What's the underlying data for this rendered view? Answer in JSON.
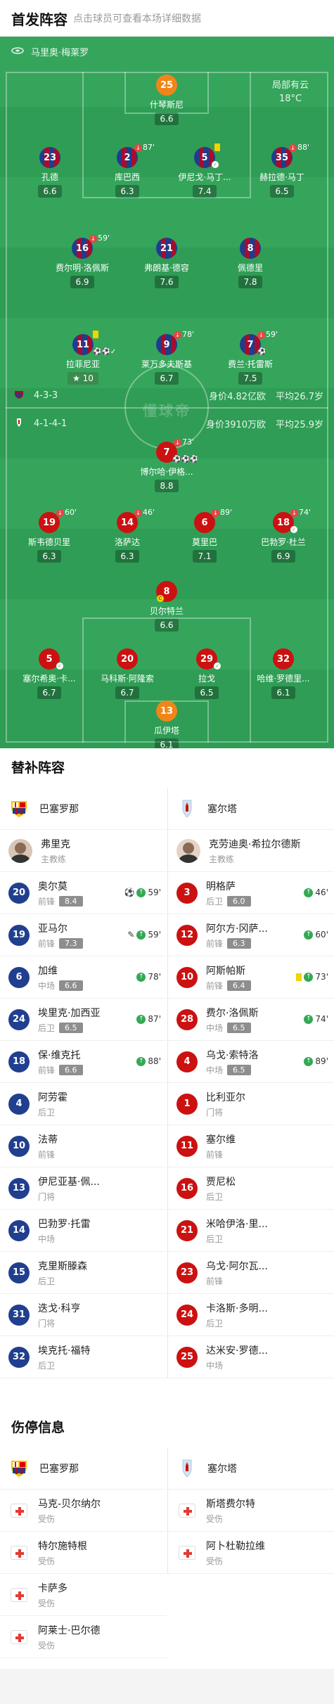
{
  "header": {
    "title": "首发阵容",
    "subtitle": "点击球员可查看本场详细数据"
  },
  "pitch": {
    "venue": "马里奥·梅莱罗",
    "weather_line1": "局部有云",
    "weather_line2": "18°C",
    "watermark": "懂球帝",
    "barca_info": {
      "formation": "4-3-3",
      "value": "身价4.82亿欧",
      "age": "平均26.7岁"
    },
    "celta_info": {
      "formation": "4-1-4-1",
      "value": "身价3910万欧",
      "age": "平均25.9岁"
    },
    "barca_players": [
      {
        "num": "25",
        "name": "什琴斯尼",
        "rating": "6.6"
      },
      {
        "num": "23",
        "name": "孔德",
        "rating": "6.6"
      },
      {
        "num": "2",
        "name": "库巴西",
        "rating": "6.3",
        "sub": "87'"
      },
      {
        "num": "5",
        "name": "伊尼戈·马丁...",
        "rating": "7.4"
      },
      {
        "num": "35",
        "name": "赫拉德·马丁",
        "rating": "6.5",
        "sub": "88'"
      },
      {
        "num": "16",
        "name": "费尔明·洛佩斯",
        "rating": "6.9",
        "sub": "59'"
      },
      {
        "num": "21",
        "name": "弗朗基·德容",
        "rating": "7.6"
      },
      {
        "num": "8",
        "name": "佩德里",
        "rating": "7.8"
      },
      {
        "num": "11",
        "name": "拉菲尼亚",
        "rating": "10",
        "star": true
      },
      {
        "num": "9",
        "name": "莱万多夫斯基",
        "rating": "6.7",
        "sub": "78'"
      },
      {
        "num": "7",
        "name": "费兰·托雷斯",
        "rating": "7.5",
        "sub": "59'"
      }
    ],
    "celta_players": [
      {
        "num": "7",
        "name": "博尔哈·伊格...",
        "rating": "8.8",
        "sub": "73'"
      },
      {
        "num": "19",
        "name": "斯韦德贝里",
        "rating": "6.3",
        "sub": "60'"
      },
      {
        "num": "14",
        "name": "洛萨达",
        "rating": "6.3",
        "sub": "46'"
      },
      {
        "num": "6",
        "name": "莫里巴",
        "rating": "7.1",
        "sub": "89'"
      },
      {
        "num": "18",
        "name": "巴勃罗·杜兰",
        "rating": "6.9",
        "sub": "74'"
      },
      {
        "num": "8",
        "name": "贝尔特兰",
        "rating": "6.6"
      },
      {
        "num": "5",
        "name": "塞尔希奥·卡...",
        "rating": "6.7"
      },
      {
        "num": "20",
        "name": "马科斯·阿隆索",
        "rating": "6.7"
      },
      {
        "num": "29",
        "name": "拉戈",
        "rating": "6.5"
      },
      {
        "num": "32",
        "name": "哈维·罗德里...",
        "rating": "6.1"
      },
      {
        "num": "13",
        "name": "瓜伊塔",
        "rating": "6.1"
      }
    ]
  },
  "subs": {
    "title": "替补阵容",
    "barca_team": "巴塞罗那",
    "celta_team": "塞尔塔",
    "barca_coach": {
      "name": "弗里克",
      "role": "主教练"
    },
    "celta_coach": {
      "name": "克劳迪奥·希拉尔德斯",
      "role": "主教练"
    },
    "barca": [
      {
        "num": "20",
        "name": "奥尔莫",
        "pos": "前锋",
        "rating": "8.4",
        "event": "59'",
        "goal": true
      },
      {
        "num": "19",
        "name": "亚马尔",
        "pos": "前锋",
        "rating": "7.3",
        "event": "59'",
        "assist": true
      },
      {
        "num": "6",
        "name": "加维",
        "pos": "中场",
        "rating": "6.6",
        "event": "78'"
      },
      {
        "num": "24",
        "name": "埃里克·加西亚",
        "pos": "后卫",
        "rating": "6.5",
        "event": "87'"
      },
      {
        "num": "18",
        "name": "保·维克托",
        "pos": "前锋",
        "rating": "6.6",
        "event": "88'"
      },
      {
        "num": "4",
        "name": "阿劳霍",
        "pos": "后卫"
      },
      {
        "num": "10",
        "name": "法蒂",
        "pos": "前锋"
      },
      {
        "num": "13",
        "name": "伊尼亚基·佩...",
        "pos": "门将"
      },
      {
        "num": "14",
        "name": "巴勃罗·托雷",
        "pos": "中场"
      },
      {
        "num": "15",
        "name": "克里斯滕森",
        "pos": "后卫"
      },
      {
        "num": "31",
        "name": "迭戈·科亨",
        "pos": "门将"
      },
      {
        "num": "32",
        "name": "埃克托·福特",
        "pos": "后卫"
      }
    ],
    "celta": [
      {
        "num": "3",
        "name": "明格萨",
        "pos": "后卫",
        "rating": "6.0",
        "event": "46'"
      },
      {
        "num": "12",
        "name": "阿尔方·冈萨...",
        "pos": "前锋",
        "rating": "6.3",
        "event": "60'"
      },
      {
        "num": "10",
        "name": "阿斯帕斯",
        "pos": "前锋",
        "rating": "6.4",
        "event": "73'",
        "yellow": true
      },
      {
        "num": "28",
        "name": "费尔·洛佩斯",
        "pos": "中场",
        "rating": "6.5",
        "event": "74'"
      },
      {
        "num": "4",
        "name": "乌戈·索特洛",
        "pos": "中场",
        "rating": "6.5",
        "event": "89'"
      },
      {
        "num": "1",
        "name": "比利亚尔",
        "pos": "门将"
      },
      {
        "num": "11",
        "name": "塞尔维",
        "pos": "前锋"
      },
      {
        "num": "16",
        "name": "贾尼松",
        "pos": "后卫"
      },
      {
        "num": "21",
        "name": "米哈伊洛·里...",
        "pos": "后卫"
      },
      {
        "num": "23",
        "name": "乌戈·阿尔瓦...",
        "pos": "前锋"
      },
      {
        "num": "24",
        "name": "卡洛斯·多明...",
        "pos": "后卫"
      },
      {
        "num": "25",
        "name": "达米安·罗德...",
        "pos": "中场"
      }
    ]
  },
  "injuries": {
    "title": "伤停信息",
    "barca_team": "巴塞罗那",
    "celta_team": "塞尔塔",
    "barca": [
      {
        "name": "马克-贝尔纳尔",
        "status": "受伤"
      },
      {
        "name": "特尔施特根",
        "status": "受伤"
      },
      {
        "name": "卡萨多",
        "status": "受伤"
      },
      {
        "name": "阿莱士·巴尔德",
        "status": "受伤"
      }
    ],
    "celta": [
      {
        "name": "斯塔费尔特",
        "status": "受伤"
      },
      {
        "name": "阿卜杜勒拉维",
        "status": "受伤"
      }
    ]
  },
  "colors": {
    "pitch": "#2f9d55",
    "barca_blue": "#213f8f",
    "barca_red": "#a50d2e",
    "celta_red": "#cc1111",
    "sub_green": "#34a853"
  }
}
